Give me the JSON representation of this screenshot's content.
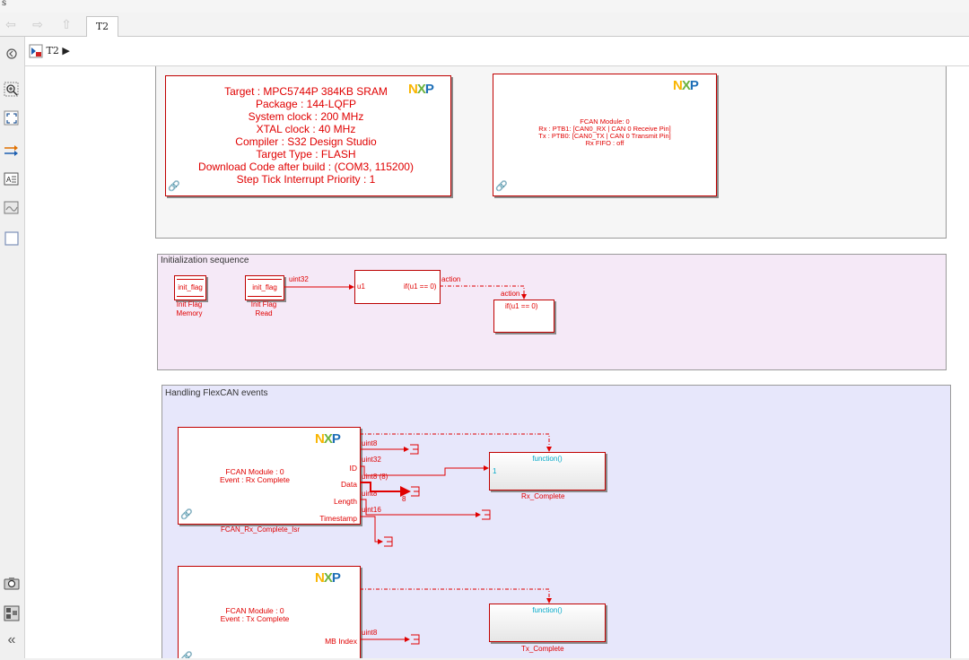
{
  "menubar": {
    "text": "s"
  },
  "nav": {
    "tab": "T2"
  },
  "address": {
    "path": "T2"
  },
  "icons": {
    "back": "back-arrow-icon",
    "forward": "forward-arrow-icon",
    "up": "up-arrow-icon",
    "zoom": "zoom-in-icon",
    "fit": "fit-to-view-icon",
    "arrows": "signal-arrows-icon",
    "annotation": "annotation-icon",
    "image": "image-icon",
    "box": "area-box-icon",
    "camera": "camera-icon",
    "explorer": "model-explorer-icon",
    "collapse": "collapse-icon",
    "logo": "simulink-logo-icon"
  },
  "colors": {
    "block_red": "#e00000",
    "cyan": "#00a8c8",
    "init_area": "#f5e9f7",
    "fcan_area": "#e7e7fb"
  },
  "config_block": {
    "lines": [
      "Target : MPC5744P 384KB SRAM",
      "Package : 144-LQFP",
      "System clock : 200 MHz",
      "XTAL clock : 40 MHz",
      "Compiler : S32 Design Studio",
      "Target Type : FLASH",
      "Download Code after build : (COM3, 115200)",
      "Step Tick Interrupt Priority : 1"
    ]
  },
  "fcan_block": {
    "lines": [
      "FCAN Module: 0",
      "Rx : PTB1: [CAN0_RX | CAN 0 Receive Pin]",
      "Tx : PTB0: [CAN0_TX | CAN 0 Transmit Pin]",
      "Rx FIFO : off"
    ]
  },
  "init": {
    "title": "Initialization sequence",
    "memory": {
      "inner": "init_flag",
      "label1": "Init Flag",
      "label2": "Memory"
    },
    "read": {
      "inner": "init_flag",
      "label1": "Init Flag",
      "label2": "Read"
    },
    "signal": "uint32",
    "if_block": {
      "port": "u1",
      "cond": "if(u1 == 0)"
    },
    "action_label1": "action",
    "action_label2": "action",
    "subsystem": {
      "text": "if(u1 == 0)"
    }
  },
  "fcan_events": {
    "title": "Handling FlexCAN events",
    "rx_isr": {
      "text1": "FCAN Module : 0",
      "text2": "Event : Rx Complete",
      "ports": [
        "ID",
        "Data",
        "Length",
        "Timestamp"
      ],
      "name": "FCAN_Rx_Complete_Isr"
    },
    "rx_signals": {
      "s1": "uint8",
      "s2": "uint32",
      "s3": "uint8 (8)",
      "s4": "uint8",
      "s5": "uint16",
      "width": "8"
    },
    "rx_complete": {
      "fn": "function()",
      "port": "1",
      "name": "Rx_Complete"
    },
    "tx_isr": {
      "text1": "FCAN Module : 0",
      "text2": "Event : Tx Complete",
      "port": "MB Index"
    },
    "tx_signals": {
      "s1": "uint8"
    },
    "tx_complete": {
      "fn": "function()",
      "name": "Tx_Complete"
    }
  }
}
